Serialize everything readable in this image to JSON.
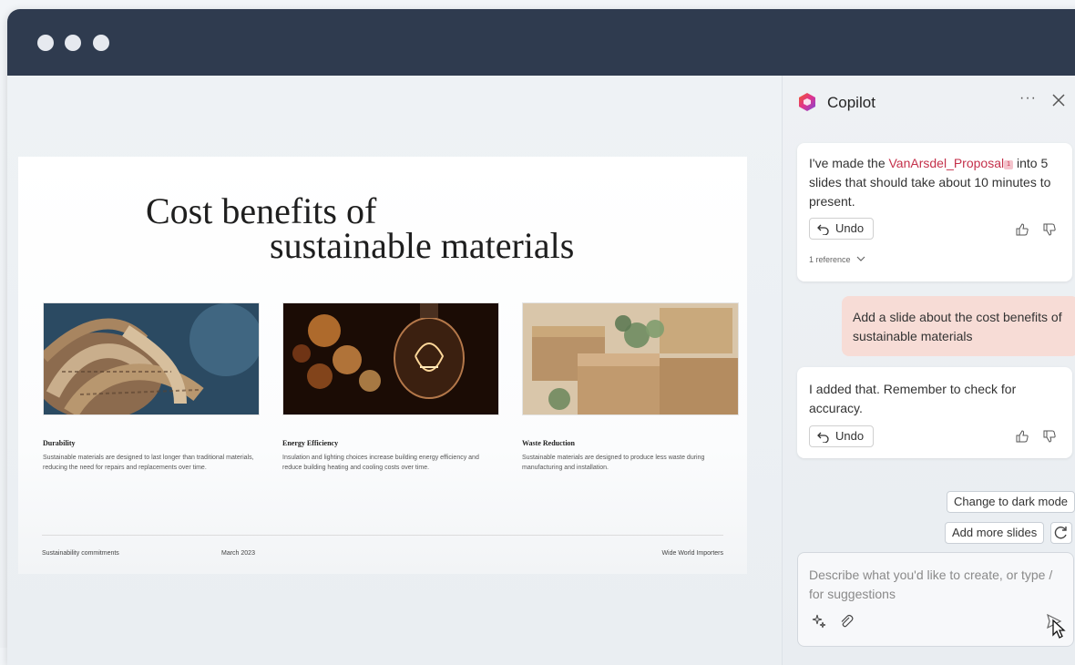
{
  "slide": {
    "title_line1": "Cost benefits of",
    "title_line2": "sustainable materials",
    "columns": [
      {
        "heading": "Durability",
        "body": "Sustainable materials are designed to last longer than traditional materials, reducing the need for repairs and replacements over time."
      },
      {
        "heading": "Energy Efficiency",
        "body": "Insulation and lighting choices increase building energy efficiency and reduce building heating and cooling costs over time."
      },
      {
        "heading": "Waste Reduction",
        "body": "Sustainable materials are designed to produce less waste during manufacturing and installation."
      }
    ],
    "footer": {
      "left": "Sustainability commitments",
      "date": "March 2023",
      "right": "Wide World Importers"
    }
  },
  "copilot": {
    "title": "Copilot",
    "more_label": "···",
    "messages": {
      "first": {
        "prefix": "I've made the ",
        "link": "VanArsdel_Proposal",
        "badge": "1",
        "suffix": " into 5 slides that should take about 10 minutes to present.",
        "undo_label": "Undo",
        "reference_label": "1 reference"
      },
      "user": "Add a slide about the cost benefits of sustainable materials",
      "second": {
        "text": "I added that. Remember to check for accuracy.",
        "undo_label": "Undo"
      }
    },
    "suggestions": {
      "dark_mode": "Change to dark mode",
      "more_slides": "Add more slides"
    },
    "input_placeholder": "Describe what you'd like to create, or type / for suggestions"
  },
  "colors": {
    "titlebar": "#2f3b4f",
    "link": "#c4314b",
    "user_bubble": "#f7dcd6"
  }
}
